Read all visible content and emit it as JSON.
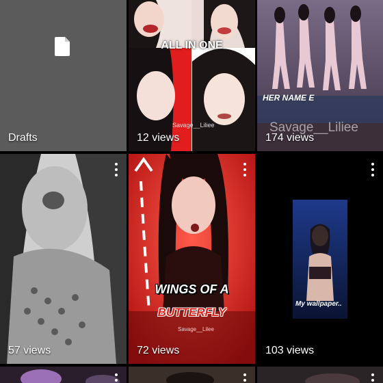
{
  "tiles": [
    {
      "type": "drafts",
      "label": "Drafts",
      "icon": "document-icon"
    },
    {
      "type": "video",
      "views": "12 views",
      "overlay": "ALL IN ONE",
      "watermark": "Savage__Liliee"
    },
    {
      "type": "video",
      "views": "174 views",
      "overlay": "HER NAME E",
      "watermark": "Savage__Liliee"
    },
    {
      "type": "video",
      "views": "57 views"
    },
    {
      "type": "video",
      "views": "72 views",
      "overlay_line1": "WINGS OF A",
      "overlay_line2": "BUTTERFLY",
      "watermark": "Savage__Lilee"
    },
    {
      "type": "video",
      "views": "103 views",
      "overlay": "My wallpaper.."
    },
    {
      "type": "video"
    },
    {
      "type": "video"
    },
    {
      "type": "video"
    }
  ],
  "colors": {
    "drafts_bg": "#5b5b5b",
    "background": "#000000",
    "butterfly_red": "#e0201a"
  }
}
